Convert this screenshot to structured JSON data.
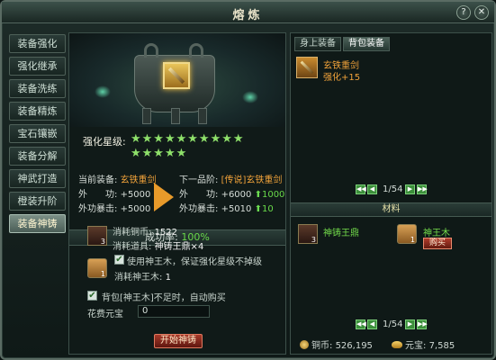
{
  "window": {
    "title": "熔炼",
    "help_label": "?",
    "close_label": "✕"
  },
  "sidebar": {
    "items": [
      {
        "label": "装备强化",
        "active": false
      },
      {
        "label": "强化继承",
        "active": false
      },
      {
        "label": "装备洗练",
        "active": false
      },
      {
        "label": "装备精炼",
        "active": false
      },
      {
        "label": "宝石镶嵌",
        "active": false
      },
      {
        "label": "装备分解",
        "active": false
      },
      {
        "label": "神武打造",
        "active": false
      },
      {
        "label": "橙装升阶",
        "active": false
      },
      {
        "label": "装备神铸",
        "active": true
      }
    ]
  },
  "forge": {
    "star_label": "强化星级:",
    "stars_row1": "★★★★★★★★★★",
    "stars_row2": "★★★★★",
    "current": {
      "label": "当前装备:",
      "name": "玄铁重剑",
      "attr1_label": "外　　功:",
      "attr1_value": "+5000",
      "attr2_label": "外功暴击:",
      "attr2_value": "+5000"
    },
    "next": {
      "label": "下一品阶:",
      "name": "[传说]玄铁重剑",
      "attr1_label": "外　　功:",
      "attr1_value": "+6000",
      "attr1_gain": "1000",
      "attr2_label": "外功暴击:",
      "attr2_value": "+5010",
      "attr2_gain": "10"
    },
    "success_rate_label": "成功率:",
    "success_rate": "100%",
    "cost_copper_label": "消耗铜币:",
    "cost_copper": "1522",
    "cost_item_label": "消耗道具:",
    "cost_item": "神铸王鼎×4",
    "cost_item_count": "3",
    "wood_check_label": "使用神王木，保证强化星级不掉级",
    "wood_cost_label": "消耗神王木:",
    "wood_cost": "1",
    "wood_count": "1",
    "autobuy_label": "背包[神王木]不足时，自动购买",
    "yuanbao_label": "花费元宝",
    "yuanbao_value": "0",
    "start_label": "开始神铸"
  },
  "inventory": {
    "tabs": [
      {
        "label": "身上装备"
      },
      {
        "label": "背包装备"
      }
    ],
    "equip_name": "玄铁重剑",
    "equip_level": "强化+15",
    "page_top": "1/54",
    "materials_title": "材料",
    "mat1_name": "神铸王鼎",
    "mat1_count": "3",
    "mat2_name": "神王木",
    "mat2_count": "1",
    "buy_label": "购买",
    "page_bottom": "1/54",
    "copper_label": "铜币:",
    "copper_value": "526,195",
    "yuanbao_label": "元宝:",
    "yuanbao_value": "7,585"
  }
}
